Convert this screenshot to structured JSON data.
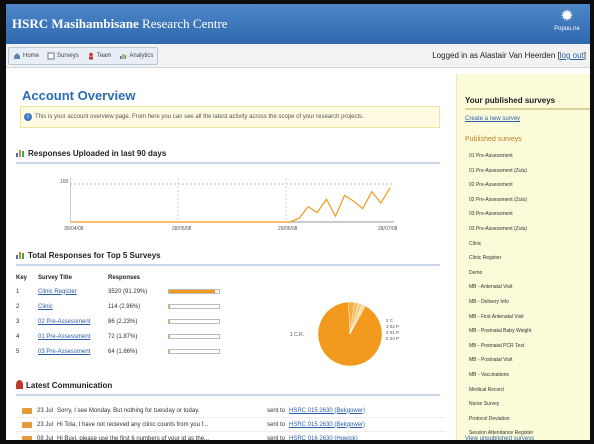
{
  "app": {
    "brand_strong": "HSRC Masihambisane",
    "brand_rest": " Research Centre",
    "logo_text": "Popuu.ne"
  },
  "nav": {
    "tabs": [
      "Home",
      "Surveys",
      "Team",
      "Analytics"
    ],
    "login_text": "Logged in as Alastair Van Heerden",
    "logout_label": "log out"
  },
  "main": {
    "title": "Account Overview",
    "info": "This is your account overview page. From here you can see all the latest activity across the scope of your research projects.",
    "responses_heading": "Responses Uploaded in last 90 days",
    "top5_heading": "Total Responses for Top 5 Surveys",
    "comm_heading": "Latest Communication"
  },
  "chart_data": {
    "type": "line",
    "y_tick": "100",
    "x_ticks": [
      "30/04/08",
      "28/05/08",
      "29/06/08",
      "28/07/08"
    ],
    "x": [
      0,
      4,
      8,
      12,
      16,
      20,
      24,
      28,
      32,
      36,
      40,
      44,
      48,
      52,
      56,
      60,
      64,
      68,
      72,
      76,
      80,
      84,
      88
    ],
    "values": [
      0,
      0,
      0,
      0,
      0,
      0,
      0,
      0,
      0,
      0,
      0,
      0,
      10,
      40,
      25,
      60,
      15,
      70,
      55,
      35,
      80,
      50,
      90
    ]
  },
  "top5": {
    "headers": [
      "Key",
      "Survey Title",
      "Responses"
    ],
    "rows": [
      {
        "key": "1",
        "title": "Clinic Register",
        "responses": "3520 (91.29%)",
        "fraction": 0.9129
      },
      {
        "key": "2",
        "title": "Clinic",
        "responses": "114 (2.96%)",
        "fraction": 0.0296
      },
      {
        "key": "3",
        "title": "02 Pre-Assessment",
        "responses": "86 (2.23%)",
        "fraction": 0.0223
      },
      {
        "key": "4",
        "title": "01 Pre-Assessment",
        "responses": "72 (1.87%)",
        "fraction": 0.0187
      },
      {
        "key": "5",
        "title": "03 Pre-Assessment",
        "responses": "64 (1.66%)",
        "fraction": 0.0166
      }
    ],
    "pie_left_label": "1 C.R.",
    "pie_labels": [
      "2 C",
      "3 02 P",
      "4 01 P",
      "5 03 P"
    ]
  },
  "communication": [
    {
      "date": "23 Jul",
      "message": "Sorry, I see Monday. But nothing for tuesday or today.",
      "sent_label": "sent to",
      "to": "HSRC 015 2630 (Bekgower)"
    },
    {
      "date": "23 Jul",
      "message": "Hi Tola, I have not recieved any clinic counts from you f...",
      "sent_label": "sent to",
      "to": "HSRC 015 2630 (Bekgower)"
    },
    {
      "date": "08 Jul",
      "message": "Hi Buyi, please use the first 6 numbers of your id as the...",
      "sent_label": "sent to",
      "to": "HSRC 016 2630 (Howick)"
    }
  ],
  "sidebar": {
    "title": "Your published surveys",
    "create_link": "Create a new survey",
    "published_heading": "Published surveys",
    "surveys": [
      "01 Pre-Assessment",
      "01 Pre-Assessment (Zulu)",
      "02 Pre-Assessment",
      "02 Pre-Assessment (Zulu)",
      "03 Pre-Assessment",
      "03 Pre-Assessment (Zulu)",
      "Clinic",
      "Clinic Register",
      "Demo",
      "MB - Antenatal Visit",
      "MB - Delivery Info",
      "MB - First Antenatal Visit",
      "MB - Postnatal Baby Weight",
      "MB - Postnatal PCR Test",
      "MB - Postnatal Visit",
      "MB - Vaccinations",
      "Medical Record",
      "Nurse Survey",
      "Protocol Deviation",
      "Session Attendance Register"
    ],
    "view_all": "View unpublished surveys"
  },
  "colors": {
    "header": "#3a75b9",
    "accent_orange": "#f29a1d",
    "link": "#2b5ea8",
    "sidebar_bg": "#fbfad9"
  }
}
